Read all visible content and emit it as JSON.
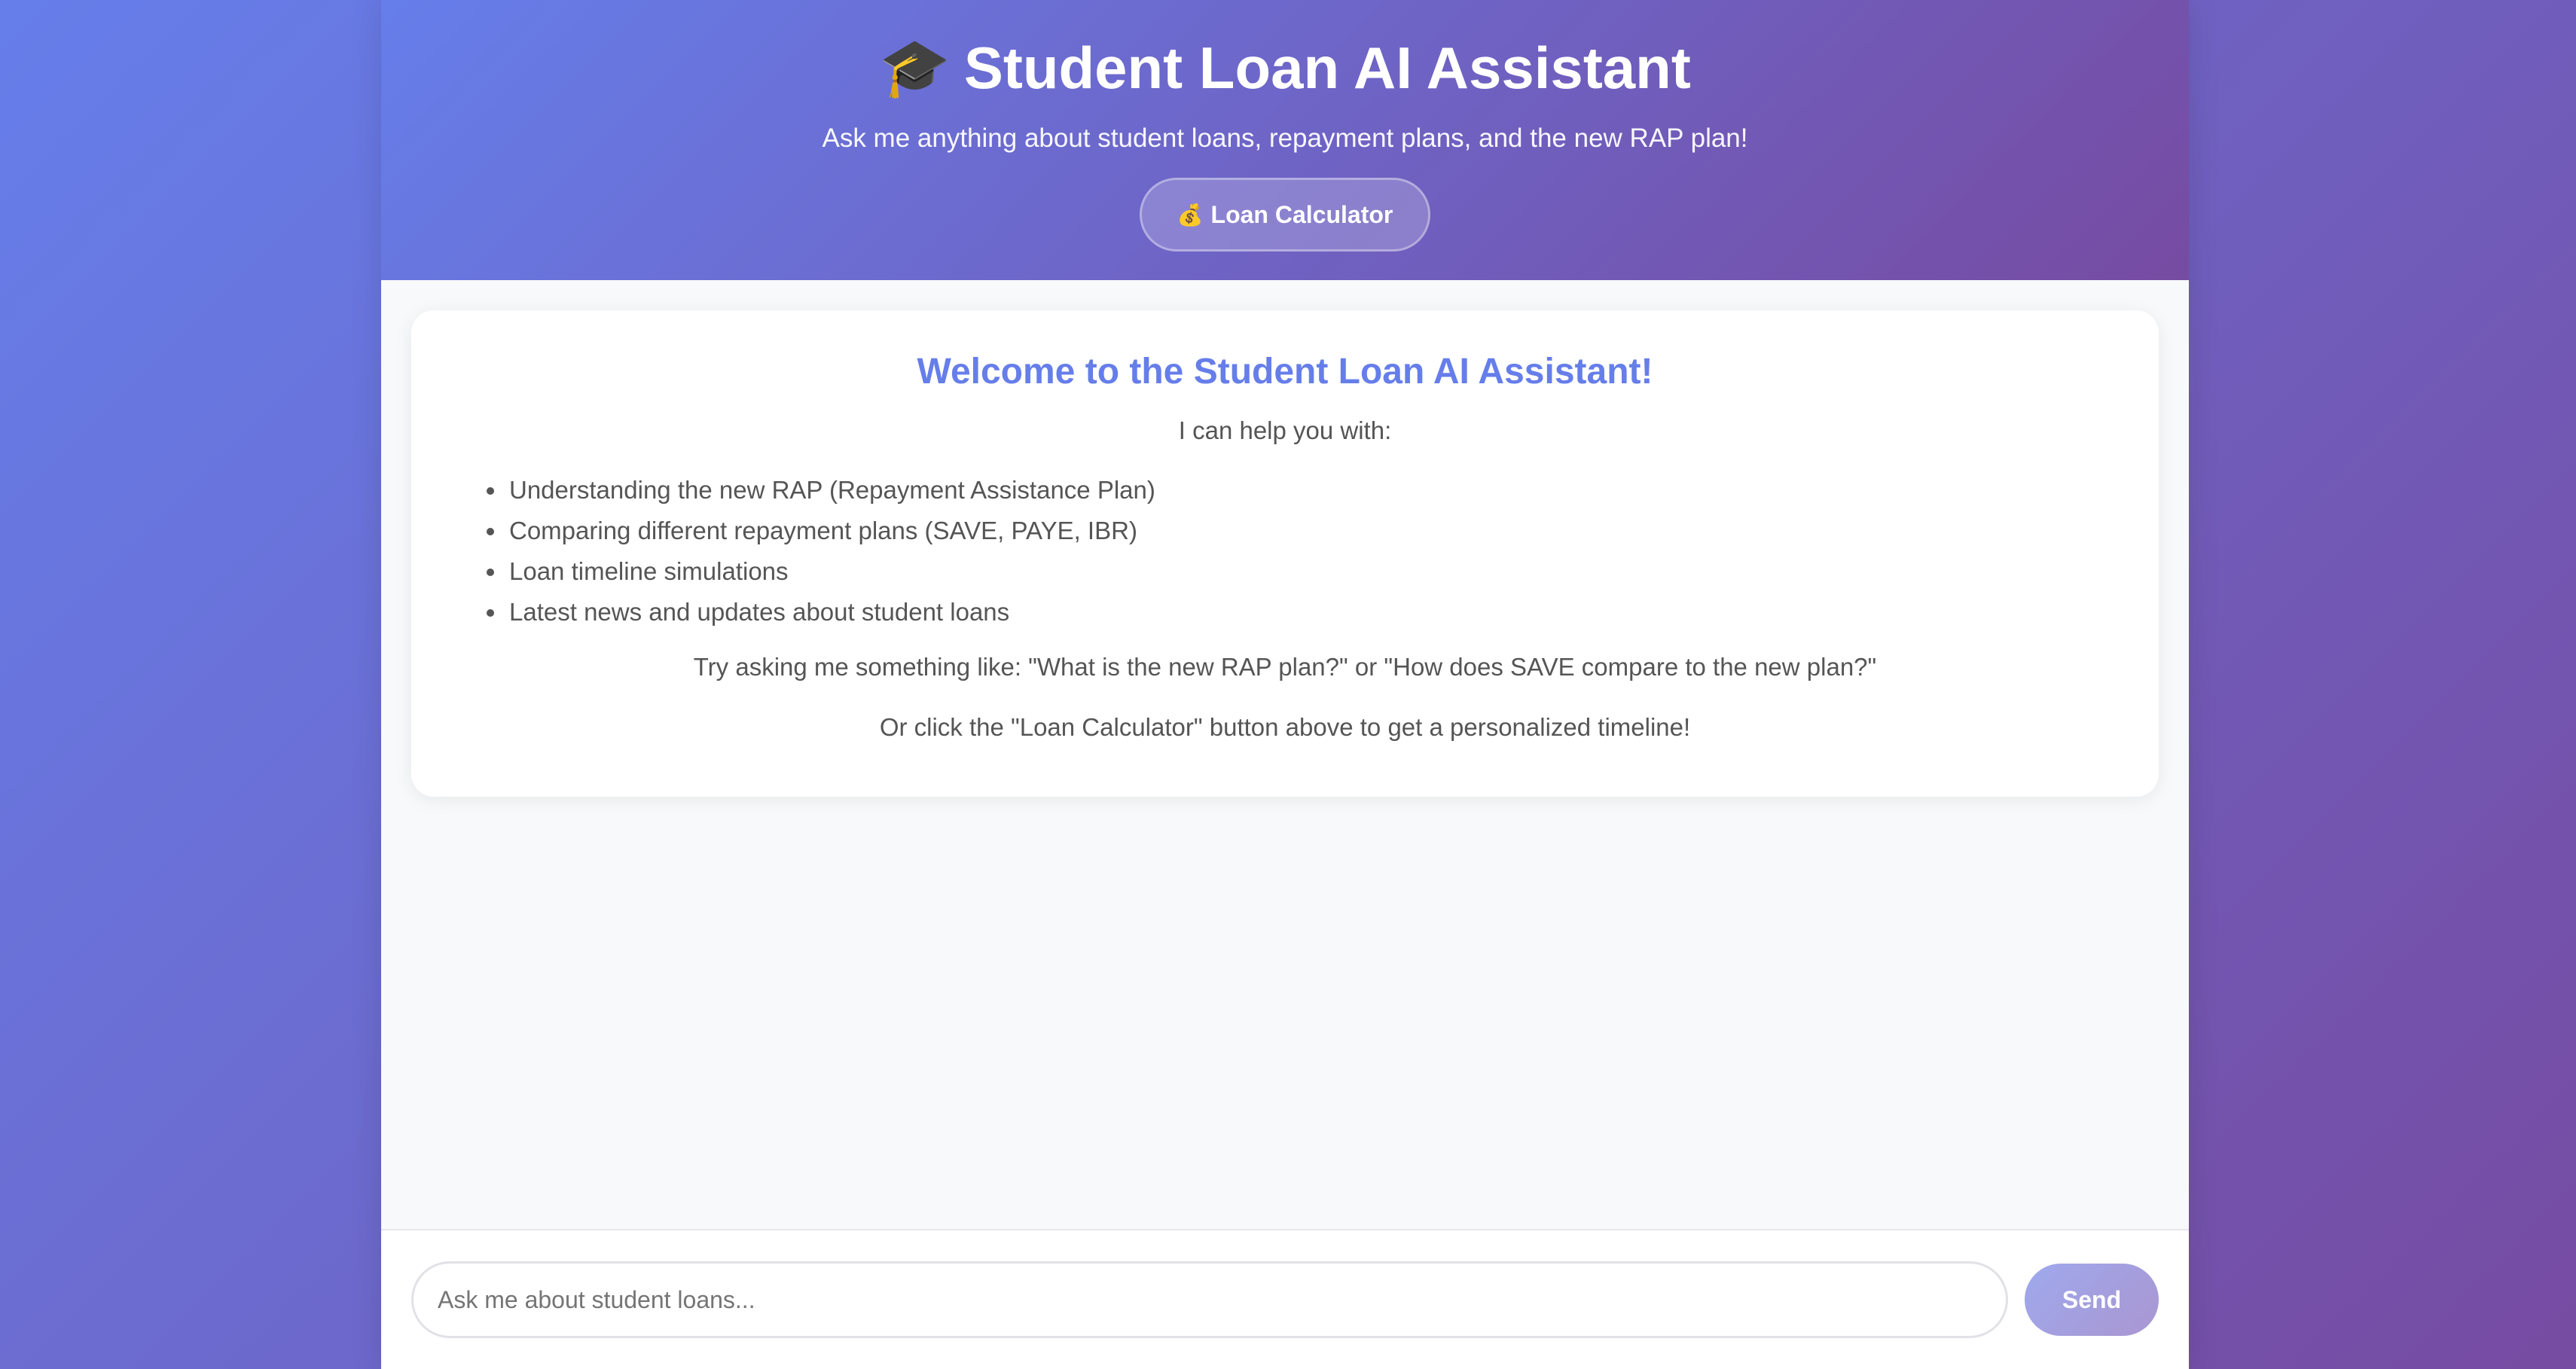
{
  "header": {
    "title": "Student Loan AI Assistant",
    "title_icon": "graduation-cap-icon",
    "subtitle": "Ask me anything about student loans, repayment plans, and the new RAP plan!",
    "calculator_button": {
      "icon": "money-bag-icon",
      "label": "Loan Calculator"
    }
  },
  "welcome": {
    "heading": "Welcome to the Student Loan AI Assistant!",
    "intro": "I can help you with:",
    "features": [
      "Understanding the new RAP (Repayment Assistance Plan)",
      "Comparing different repayment plans (SAVE, PAYE, IBR)",
      "Loan timeline simulations",
      "Latest news and updates about student loans"
    ],
    "tip_example": "Try asking me something like: \"What is the new RAP plan?\" or \"How does SAVE compare to the new plan?\"",
    "tip_calculator": "Or click the \"Loan Calculator\" button above to get a personalized timeline!"
  },
  "composer": {
    "placeholder": "Ask me about student loans...",
    "value": "",
    "send_label": "Send"
  },
  "colors": {
    "gradient_start": "#667eea",
    "gradient_end": "#764ba2",
    "accent": "#667eea",
    "send_button": "#a29fe0"
  }
}
